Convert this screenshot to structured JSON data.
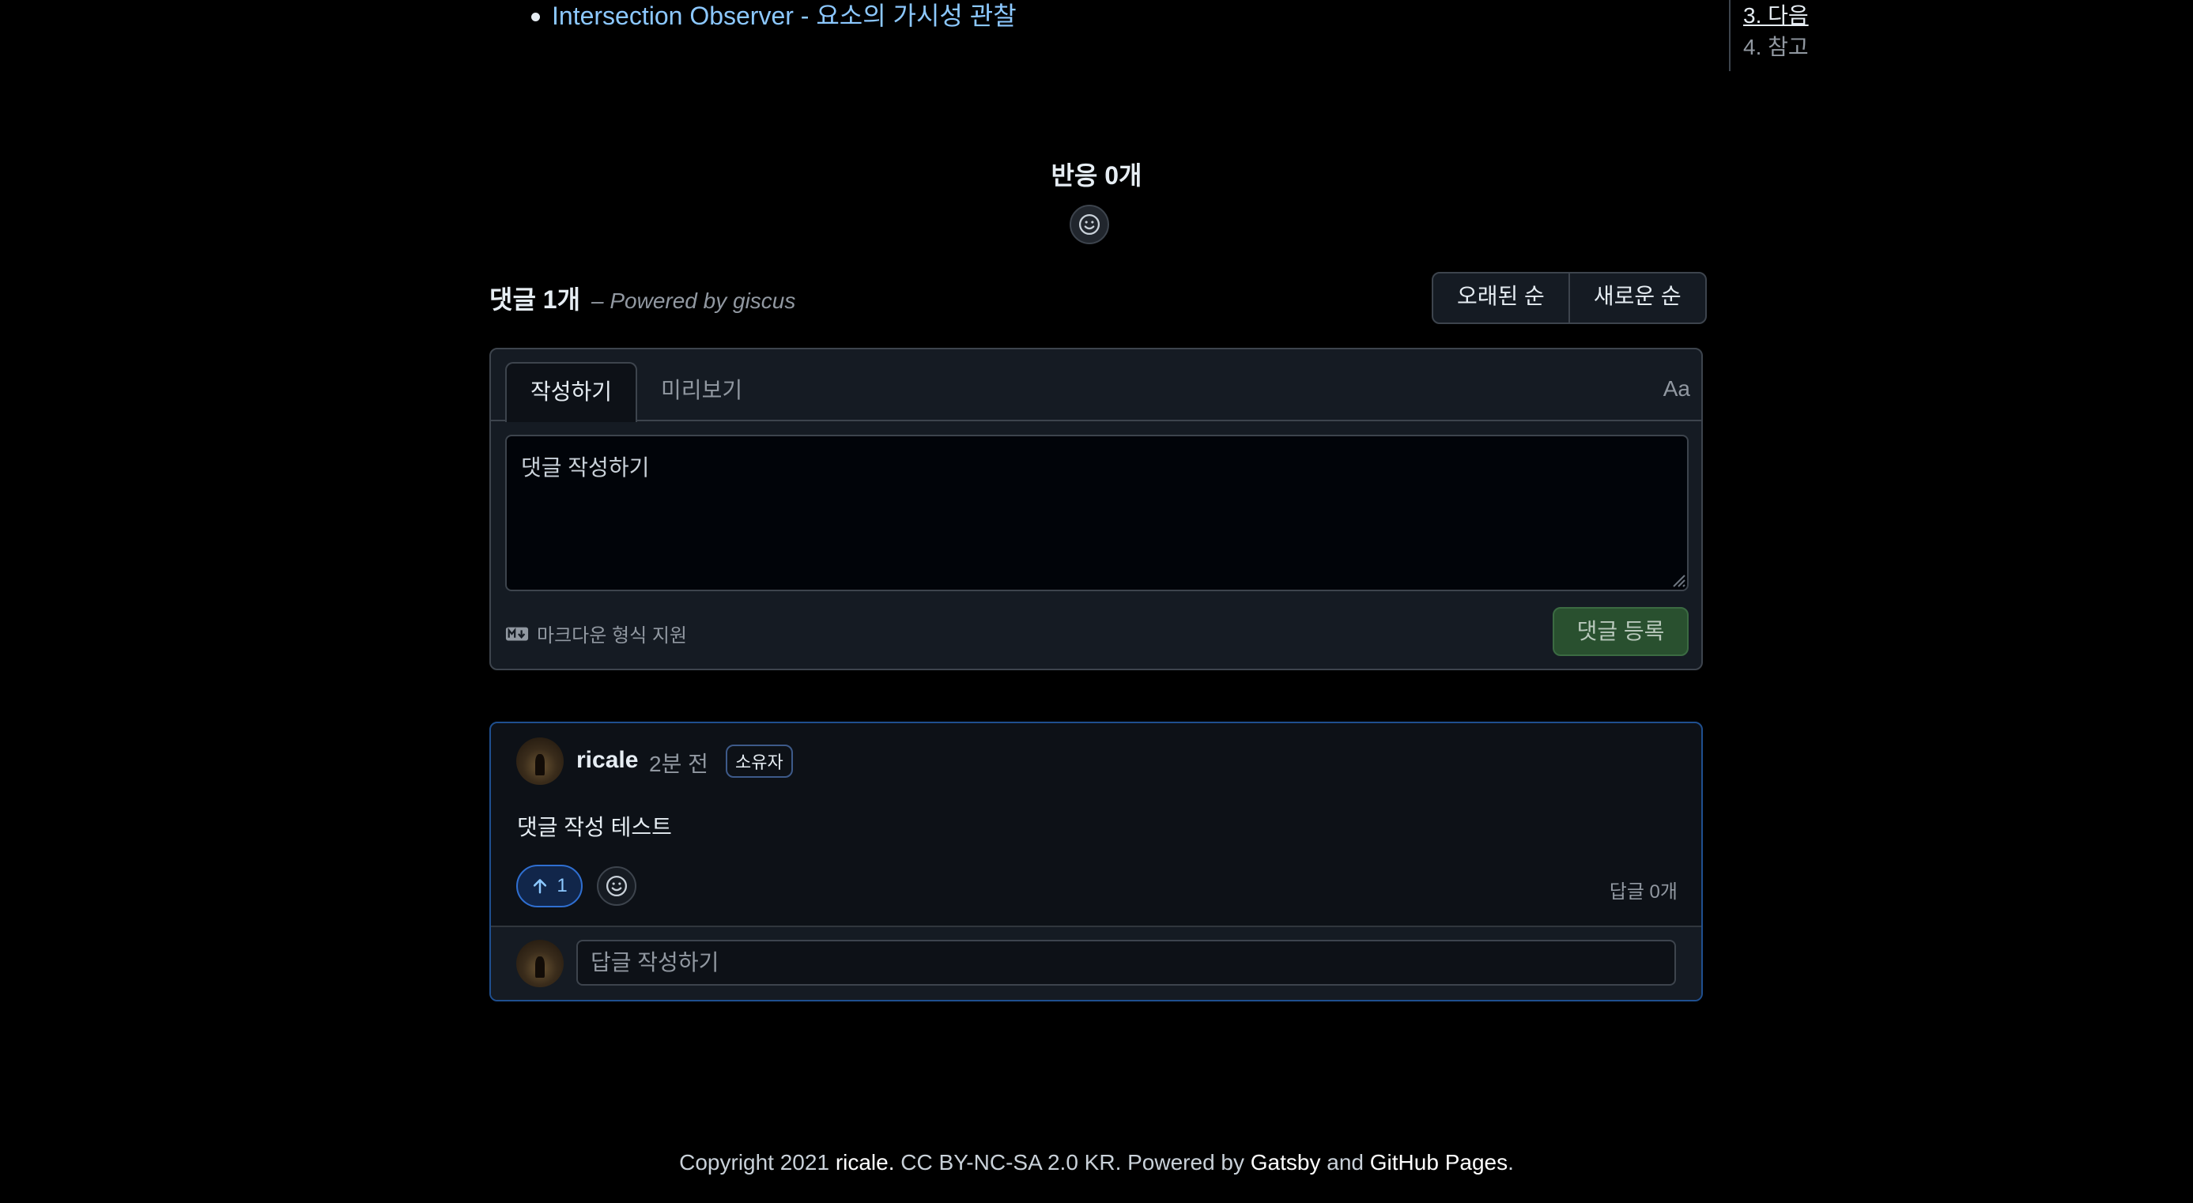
{
  "top_links": [
    {
      "label": "Intersection Observer - 요소의 가시성 관찰"
    }
  ],
  "toc": {
    "items": [
      {
        "label": "3. 다음",
        "active": true
      },
      {
        "label": "4. 참고",
        "active": false
      }
    ]
  },
  "reactions": {
    "title": "반응 0개",
    "add_icon": "smiley-icon"
  },
  "comments_header": {
    "count_label": "댓글 1개",
    "powered_by": "– Powered by giscus",
    "sort_options": [
      "오래된 순",
      "새로운 순"
    ]
  },
  "editor": {
    "tabs": [
      "작성하기",
      "미리보기"
    ],
    "font_toggle": "Aa",
    "placeholder": "댓글 작성하기",
    "markdown_note": "마크다운 형식 지원",
    "submit_label": "댓글 등록"
  },
  "comment": {
    "author": "ricale",
    "time": "2분 전",
    "badge": "소유자",
    "body": "댓글 작성 테스트",
    "upvotes": "1",
    "reply_count": "답글 0개",
    "reply_placeholder": "답글 작성하기"
  },
  "footer": {
    "copyright": "Copyright 2021",
    "owner": "ricale.",
    "license": "CC BY-NC-SA 2.0 KR. Powered by",
    "gatsby": "Gatsby",
    "and": "and",
    "github_pages": "GitHub Pages",
    "period": "."
  },
  "colors": {
    "background": "#000000",
    "link": "#8cc8ff",
    "submit_bg": "#29502f",
    "comment_border": "#1f4f8f"
  }
}
